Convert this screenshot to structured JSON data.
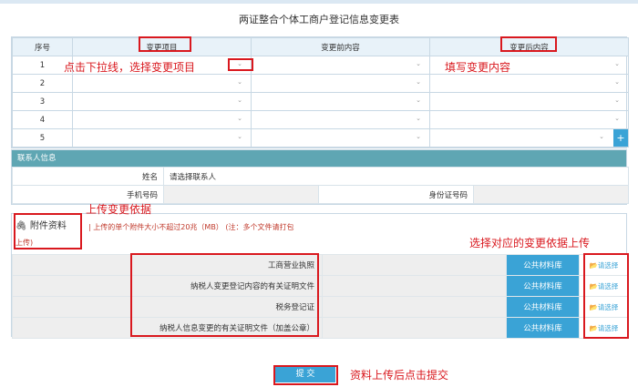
{
  "title": "两证整合个体工商户登记信息变更表",
  "table": {
    "headers": [
      "序号",
      "变更项目",
      "变更前内容",
      "变更后内容"
    ],
    "rows": [
      "1",
      "2",
      "3",
      "4",
      "5"
    ],
    "plus": "+"
  },
  "contact": {
    "header": "联系人信息",
    "name_label": "姓名",
    "name_value": "请选择联系人",
    "phone_label": "手机号码",
    "id_label": "身份证号码"
  },
  "attach": {
    "title": "附件资料",
    "note": "| 上传的单个附件大小不超过20兆（MB） (注：多个文件请打包",
    "note2": "上传)",
    "files": [
      {
        "name": "工商营业执照",
        "library": "公共材料库",
        "pick": "请选择"
      },
      {
        "name": "纳税人变更登记内容的有关证明文件",
        "library": "公共材料库",
        "pick": "请选择"
      },
      {
        "name": "税务登记证",
        "library": "公共材料库",
        "pick": "请选择"
      },
      {
        "name": "纳税人信息变更的有关证明文件（加盖公章）",
        "library": "公共材料库",
        "pick": "请选择"
      }
    ]
  },
  "submit_label": "提 交",
  "annotations": {
    "a1": "点击下拉线，选择变更项目",
    "a2": "填写变更内容",
    "a3": "上传变更依据",
    "a4": "选择对应的变更依据上传",
    "a5": "资料上传后点击提交"
  }
}
